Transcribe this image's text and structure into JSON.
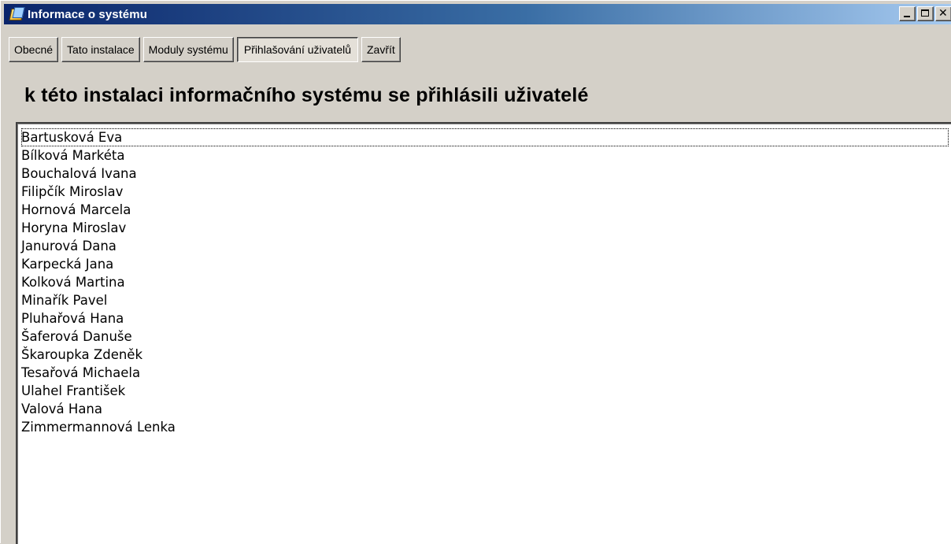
{
  "window": {
    "title": "Informace o systému",
    "controls": {
      "minimize_icon": "minimize-icon",
      "maximize_icon": "maximize-icon",
      "close_icon": "close-icon",
      "close_glyph": "✕"
    }
  },
  "toolbar": {
    "tabs": [
      {
        "label": "Obecné"
      },
      {
        "label": "Tato instalace"
      },
      {
        "label": "Moduly systému"
      },
      {
        "label": "Přihlašování uživatelů",
        "active": true
      },
      {
        "label": "Zavřít"
      }
    ]
  },
  "main": {
    "heading": "k této instalaci informačního systému se přihlásili uživatelé",
    "users": [
      "Bartusková Eva",
      "Bílková Markéta",
      "Bouchalová Ivana",
      "Filipčík Miroslav",
      "Hornová Marcela",
      "Horyna Miroslav",
      "Janurová Dana",
      "Karpecká Jana",
      "Kolková Martina",
      "Minařík Pavel",
      "Pluhařová Hana",
      "Šaferová Danuše",
      "Škaroupka Zdeněk",
      "Tesařová Michaela",
      "Ulahel František",
      "Valová Hana",
      "Zimmermannová Lenka"
    ],
    "focused_index": 0
  },
  "colors": {
    "titlebar_start": "#0a246a",
    "titlebar_end": "#a6caf0",
    "face": "#d4d0c8"
  }
}
